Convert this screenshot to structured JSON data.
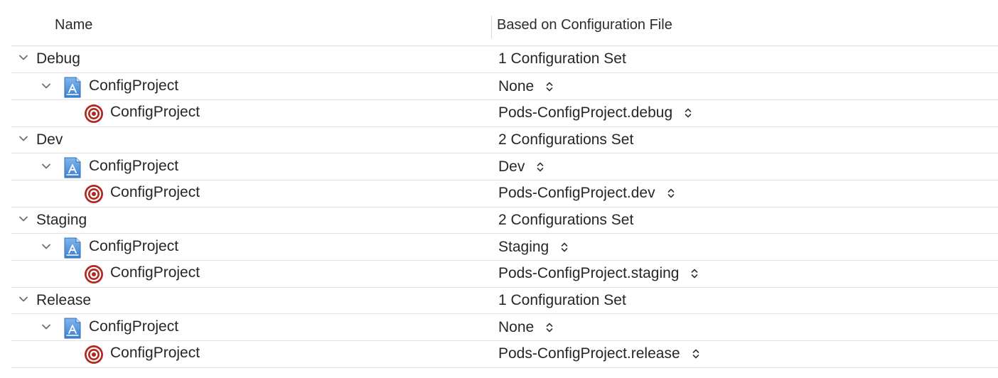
{
  "header": {
    "name_label": "Name",
    "file_label": "Based on Configuration File"
  },
  "configurations": [
    {
      "name": "Debug",
      "summary": "1 Configuration Set",
      "project": {
        "name": "ConfigProject",
        "file": "None"
      },
      "target": {
        "name": "ConfigProject",
        "file": "Pods-ConfigProject.debug"
      }
    },
    {
      "name": "Dev",
      "summary": "2 Configurations Set",
      "project": {
        "name": "ConfigProject",
        "file": "Dev"
      },
      "target": {
        "name": "ConfigProject",
        "file": "Pods-ConfigProject.dev"
      }
    },
    {
      "name": "Staging",
      "summary": "2 Configurations Set",
      "project": {
        "name": "ConfigProject",
        "file": "Staging"
      },
      "target": {
        "name": "ConfigProject",
        "file": "Pods-ConfigProject.staging"
      }
    },
    {
      "name": "Release",
      "summary": "1 Configuration Set",
      "project": {
        "name": "ConfigProject",
        "file": "None"
      },
      "target": {
        "name": "ConfigProject",
        "file": "Pods-ConfigProject.release"
      }
    }
  ],
  "icons": {
    "disclosure": "chevron-down-icon",
    "project": "xcode-project-icon",
    "target": "target-icon",
    "popup": "up-down-stepper-icon"
  },
  "colors": {
    "target_red": "#b3261e",
    "project_blue": "#4a90d9",
    "separator": "#e2e2e2",
    "text": "#262626"
  }
}
